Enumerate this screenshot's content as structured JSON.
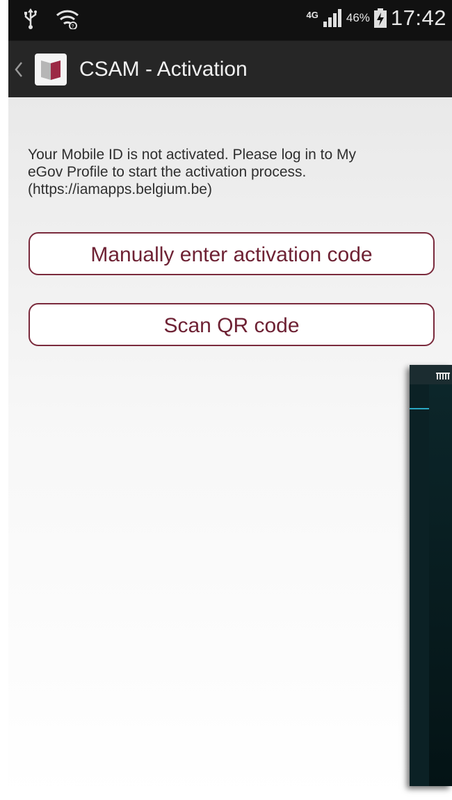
{
  "status_bar": {
    "icons": [
      "usb-icon",
      "wifi-icon",
      "network-4g-icon",
      "signal-icon",
      "battery-charging-icon"
    ],
    "network": "4G",
    "battery_percent": "46%",
    "time": "17:42"
  },
  "action_bar": {
    "title": "CSAM - Activation",
    "back_icon": "chevron-left-icon",
    "app_icon": "csam-logo-icon"
  },
  "main": {
    "message_lines": [
      "Your Mobile ID is not activated. Please log in to My",
      "eGov Profile to start the activation process.",
      " (https://iamapps.belgium.be)"
    ],
    "manual_button_label": "Manually enter activation code",
    "scan_button_label": "Scan QR code"
  },
  "colors": {
    "accent": "#7a2a3c",
    "status_bar_bg": "#111111",
    "action_bar_bg": "#262626"
  }
}
